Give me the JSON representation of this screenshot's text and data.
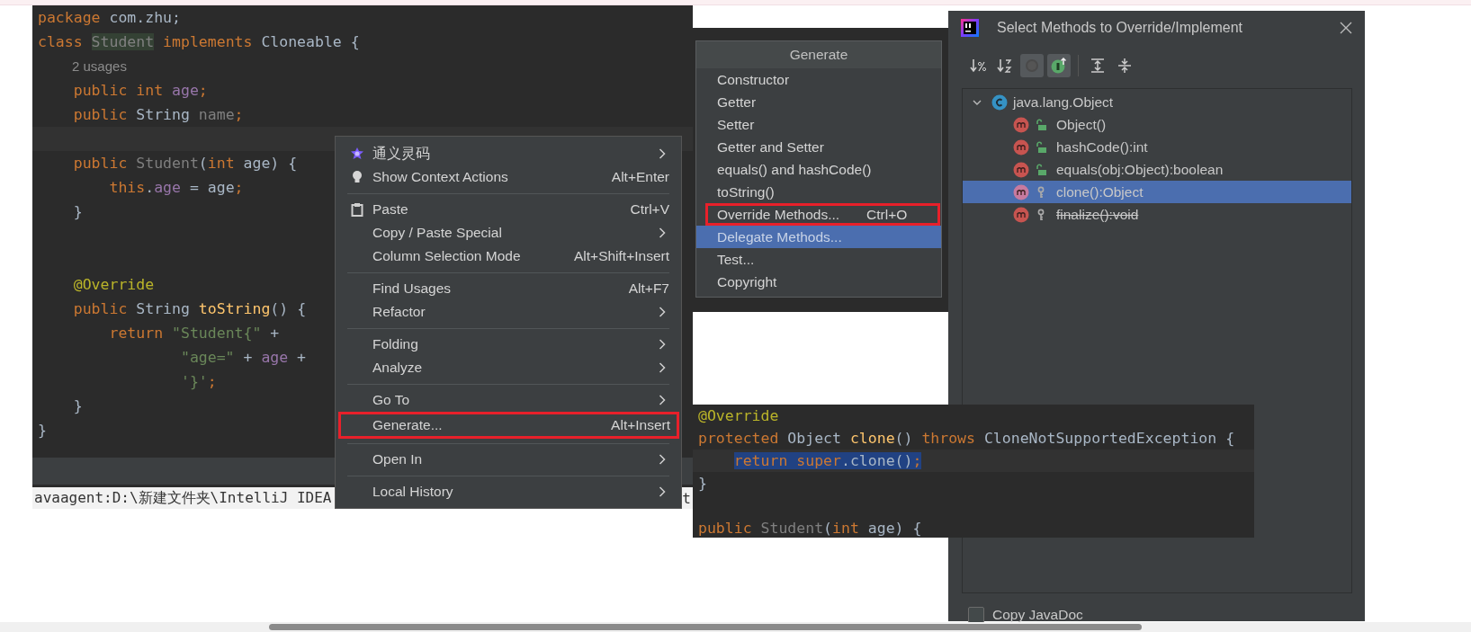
{
  "editor": {
    "lines": [
      {
        "kind": "code",
        "current": false,
        "tokens": [
          {
            "text": "package ",
            "kind": "kw"
          },
          {
            "text": "com.zhu;",
            "kind": "plain"
          }
        ]
      },
      {
        "kind": "code",
        "current": false,
        "tokens": [
          {
            "text": "class ",
            "kind": "kw"
          },
          {
            "text": "Student",
            "kind": "usage"
          },
          {
            "text": " implements ",
            "kind": "kw"
          },
          {
            "text": "Cloneable {",
            "kind": "plain"
          }
        ]
      },
      {
        "kind": "hint",
        "text": "2 usages"
      },
      {
        "kind": "code",
        "current": false,
        "tokens": [
          {
            "text": "    public int ",
            "kind": "kw"
          },
          {
            "text": "age",
            "kind": "field"
          },
          {
            "text": ";",
            "kind": "kw"
          }
        ]
      },
      {
        "kind": "code",
        "current": false,
        "tokens": [
          {
            "text": "    public ",
            "kind": "kw"
          },
          {
            "text": "String ",
            "kind": "plain"
          },
          {
            "text": "name",
            "kind": "unused"
          },
          {
            "text": ";",
            "kind": "kw"
          }
        ]
      },
      {
        "kind": "blank",
        "current": true
      },
      {
        "kind": "code",
        "current": false,
        "tokens": [
          {
            "text": "    public ",
            "kind": "kw"
          },
          {
            "text": "Student",
            "kind": "unused"
          },
          {
            "text": "(",
            "kind": "plain"
          },
          {
            "text": "int ",
            "kind": "kw"
          },
          {
            "text": "age) {",
            "kind": "plain"
          }
        ]
      },
      {
        "kind": "code",
        "current": false,
        "tokens": [
          {
            "text": "        this",
            "kind": "kw"
          },
          {
            "text": ".",
            "kind": "plain"
          },
          {
            "text": "age",
            "kind": "field"
          },
          {
            "text": " = age",
            "kind": "plain"
          },
          {
            "text": ";",
            "kind": "kw"
          }
        ]
      },
      {
        "kind": "code",
        "current": false,
        "tokens": [
          {
            "text": "    }",
            "kind": "plain"
          }
        ]
      },
      {
        "kind": "blank"
      },
      {
        "kind": "blank"
      },
      {
        "kind": "code",
        "current": false,
        "tokens": [
          {
            "text": "    @Override",
            "kind": "anno"
          }
        ]
      },
      {
        "kind": "code",
        "current": false,
        "tokens": [
          {
            "text": "    public ",
            "kind": "kw"
          },
          {
            "text": "String ",
            "kind": "plain"
          },
          {
            "text": "toString",
            "kind": "method"
          },
          {
            "text": "() {",
            "kind": "plain"
          }
        ]
      },
      {
        "kind": "code",
        "current": false,
        "tokens": [
          {
            "text": "        return ",
            "kind": "kw"
          },
          {
            "text": "\"Student{\"",
            "kind": "str"
          },
          {
            "text": " +",
            "kind": "plain"
          }
        ]
      },
      {
        "kind": "code",
        "current": false,
        "tokens": [
          {
            "text": "                \"age=\"",
            "kind": "str"
          },
          {
            "text": " + ",
            "kind": "plain"
          },
          {
            "text": "age",
            "kind": "field"
          },
          {
            "text": " +",
            "kind": "plain"
          }
        ]
      },
      {
        "kind": "code",
        "current": false,
        "tokens": [
          {
            "text": "                '}'",
            "kind": "str"
          },
          {
            "text": ";",
            "kind": "kw"
          }
        ]
      },
      {
        "kind": "code",
        "current": false,
        "tokens": [
          {
            "text": "    }",
            "kind": "plain"
          }
        ]
      },
      {
        "kind": "code",
        "current": false,
        "tokens": [
          {
            "text": "}",
            "kind": "plain"
          }
        ]
      }
    ],
    "status_text": "avaagent:D:\\新建文件夹\\IntelliJ IDEA",
    "status_tail": "t"
  },
  "context_menu": {
    "groups": [
      [
        {
          "label": "通义灵码",
          "kind": "plugin",
          "submenu": true
        },
        {
          "label": "Show Context Actions",
          "kind": "intention",
          "submenu": false,
          "shortcut": "Alt+Enter"
        }
      ],
      [
        {
          "label": "Paste",
          "kind": "clipboard",
          "submenu": false,
          "shortcut": "Ctrl+V"
        },
        {
          "label": "Copy / Paste Special",
          "kind": "plain",
          "submenu": true
        },
        {
          "label": "Column Selection Mode",
          "kind": "plain",
          "submenu": false,
          "shortcut": "Alt+Shift+Insert"
        }
      ],
      [
        {
          "label": "Find Usages",
          "kind": "plain",
          "submenu": false,
          "shortcut": "Alt+F7"
        },
        {
          "label": "Refactor",
          "kind": "plain",
          "submenu": true
        }
      ],
      [
        {
          "label": "Folding",
          "kind": "plain",
          "submenu": true
        },
        {
          "label": "Analyze",
          "kind": "plain",
          "submenu": true
        }
      ],
      [
        {
          "label": "Go To",
          "kind": "plain",
          "submenu": true
        },
        {
          "label": "Generate...",
          "kind": "plain",
          "submenu": false,
          "shortcut": "Alt+Insert",
          "outlined": true
        }
      ],
      [
        {
          "label": "Open In",
          "kind": "plain",
          "submenu": true
        }
      ],
      [
        {
          "label": "Local History",
          "kind": "plain",
          "submenu": true
        }
      ]
    ]
  },
  "generate_popup": {
    "title": "Generate",
    "items": [
      {
        "label": "Constructor",
        "selected": false,
        "outlined": false
      },
      {
        "label": "Getter",
        "selected": false,
        "outlined": false
      },
      {
        "label": "Setter",
        "selected": false,
        "outlined": false
      },
      {
        "label": "Getter and Setter",
        "selected": false,
        "outlined": false
      },
      {
        "label": "equals() and hashCode()",
        "selected": false,
        "outlined": false
      },
      {
        "label": "toString()",
        "selected": false,
        "outlined": false
      },
      {
        "label": "Override Methods...",
        "shortcut": "Ctrl+O",
        "selected": false,
        "outlined": true
      },
      {
        "label": "Delegate Methods...",
        "selected": true,
        "outlined": false
      },
      {
        "label": "Test...",
        "selected": false,
        "outlined": false
      },
      {
        "label": "Copyright",
        "selected": false,
        "outlined": false
      }
    ]
  },
  "code_snippet": {
    "lines": [
      {
        "kind": "code",
        "current": false,
        "tokens": [
          {
            "text": "@Override",
            "kind": "anno"
          }
        ]
      },
      {
        "kind": "code",
        "current": false,
        "tokens": [
          {
            "text": "protected ",
            "kind": "kw"
          },
          {
            "text": "Object ",
            "kind": "plain"
          },
          {
            "text": "clone",
            "kind": "method"
          },
          {
            "text": "() ",
            "kind": "plain"
          },
          {
            "text": "throws ",
            "kind": "kw"
          },
          {
            "text": "CloneNotSupportedException {",
            "kind": "plain"
          }
        ]
      },
      {
        "kind": "code",
        "current": true,
        "tokens": [
          {
            "text": "    return super",
            "kind": "kw",
            "sel": true
          },
          {
            "text": ".clone()",
            "kind": "plain",
            "sel": true
          },
          {
            "text": ";",
            "kind": "kw",
            "sel": true
          }
        ]
      },
      {
        "kind": "code",
        "current": false,
        "tokens": [
          {
            "text": "}",
            "kind": "plain"
          }
        ]
      },
      {
        "kind": "blank"
      },
      {
        "kind": "code",
        "current": false,
        "tokens": [
          {
            "text": "public ",
            "kind": "kw"
          },
          {
            "text": "Student",
            "kind": "unused"
          },
          {
            "text": "(",
            "kind": "plain"
          },
          {
            "text": "int ",
            "kind": "kw"
          },
          {
            "text": "age) {",
            "kind": "plain"
          }
        ]
      }
    ]
  },
  "dialog": {
    "title": "Select Methods to Override/Implement",
    "toolbar": [
      {
        "kind": "sort-visibility",
        "selected": false
      },
      {
        "kind": "sort-alpha",
        "selected": false
      },
      {
        "kind": "show-classes",
        "selected": true
      },
      {
        "kind": "show-interfaces",
        "selected": true
      },
      {
        "kind": "expand-all",
        "selected": false
      },
      {
        "kind": "collapse-all",
        "selected": false
      }
    ],
    "tree": [
      {
        "label": "java.lang.Object",
        "expanded": true,
        "children": [
          {
            "label": "Object()",
            "kind": "public",
            "selected": false,
            "deprecated": false
          },
          {
            "label": "hashCode():int",
            "kind": "public",
            "selected": false,
            "deprecated": false
          },
          {
            "label": "equals(obj:Object):boolean",
            "kind": "public",
            "selected": false,
            "deprecated": false
          },
          {
            "label": "clone():Object",
            "kind": "protected",
            "selected": true,
            "deprecated": false
          },
          {
            "label": "finalize():void",
            "kind": "protected",
            "selected": false,
            "deprecated": true
          }
        ]
      }
    ],
    "copy_javadoc": {
      "label": "Copy JavaDoc",
      "checked": false
    }
  }
}
